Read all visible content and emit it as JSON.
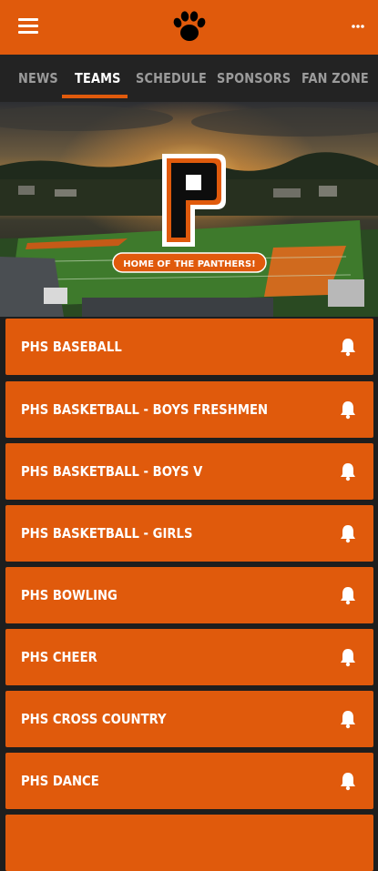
{
  "app_bar": {
    "menu_icon": "hamburger-menu-icon",
    "logo_icon": "paw-print-icon",
    "more_icon": "more-options-icon",
    "background_color": "#e05a0c"
  },
  "tabs": [
    {
      "label": "NEWS",
      "active": false
    },
    {
      "label": "TEAMS",
      "active": true
    },
    {
      "label": "SCHEDULE",
      "active": false
    },
    {
      "label": "SPONSORS",
      "active": false
    },
    {
      "label": "FAN ZONE",
      "active": false
    }
  ],
  "hero": {
    "logo_letter": "P",
    "banner_text": "HOME OF THE PANTHERS!"
  },
  "teams": [
    {
      "name": "PHS BASEBALL",
      "icon": "bell-icon"
    },
    {
      "name": "PHS BASKETBALL - BOYS FRESHMEN",
      "icon": "bell-icon"
    },
    {
      "name": "PHS BASKETBALL - BOYS V",
      "icon": "bell-icon"
    },
    {
      "name": "PHS BASKETBALL - GIRLS",
      "icon": "bell-icon"
    },
    {
      "name": "PHS BOWLING",
      "icon": "bell-icon"
    },
    {
      "name": "PHS CHEER",
      "icon": "bell-icon"
    },
    {
      "name": "PHS CROSS COUNTRY",
      "icon": "bell-icon"
    },
    {
      "name": "PHS DANCE",
      "icon": "bell-icon"
    }
  ],
  "colors": {
    "accent": "#e05a0c",
    "tab_bar": "#232323",
    "tab_inactive": "#9b9b9b",
    "tab_active": "#ffffff"
  }
}
